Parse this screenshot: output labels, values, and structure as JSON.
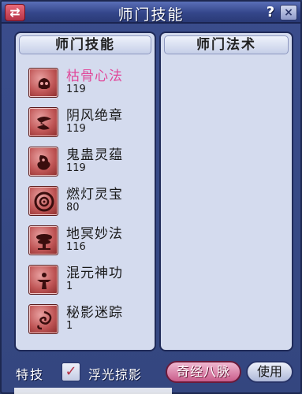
{
  "window": {
    "title": "师门技能",
    "swap_glyph": "⇄",
    "help_glyph": "?",
    "close_glyph": "×"
  },
  "left_panel": {
    "header": "师门技能",
    "skills": [
      {
        "name": "枯骨心法",
        "level": "119",
        "icon": "skull-icon",
        "active": true
      },
      {
        "name": "阴风绝章",
        "level": "119",
        "icon": "wind-scroll-icon",
        "active": false
      },
      {
        "name": "鬼蛊灵蕴",
        "level": "119",
        "icon": "ghost-spirit-icon",
        "active": false
      },
      {
        "name": "燃灯灵宝",
        "level": "80",
        "icon": "lamp-ring-icon",
        "active": false
      },
      {
        "name": "地冥妙法",
        "level": "116",
        "icon": "tree-icon",
        "active": false
      },
      {
        "name": "混元神功",
        "level": "1",
        "icon": "figure-icon",
        "active": false
      },
      {
        "name": "秘影迷踪",
        "level": "1",
        "icon": "swirl-icon",
        "active": false
      }
    ]
  },
  "right_panel": {
    "header": "师门法术"
  },
  "bottom": {
    "special_label": "特技",
    "checkbox_label": "浮光掠影",
    "checkbox_checked": true,
    "meridian_button": "奇经八脉",
    "use_button": "使用"
  },
  "colors": {
    "window_bg": "#3a4d8c",
    "panel_bg": "#d4dbee",
    "active_skill": "#e0489a",
    "meridian_button": "#c95c8a"
  }
}
